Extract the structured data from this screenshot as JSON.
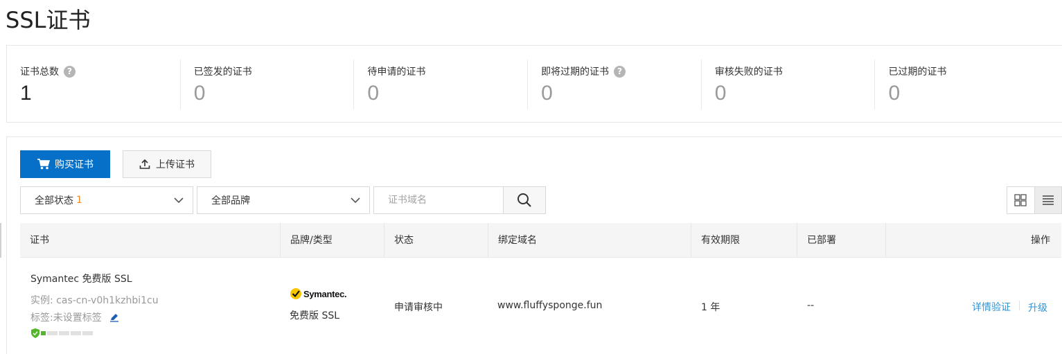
{
  "page": {
    "title": "SSL证书"
  },
  "stats": [
    {
      "label": "证书总数",
      "value": "1",
      "help": true
    },
    {
      "label": "已签发的证书",
      "value": "0",
      "help": false
    },
    {
      "label": "待申请的证书",
      "value": "0",
      "help": false
    },
    {
      "label": "即将过期的证书",
      "value": "0",
      "help": true
    },
    {
      "label": "审核失败的证书",
      "value": "0",
      "help": false
    },
    {
      "label": "已过期的证书",
      "value": "0",
      "help": false
    }
  ],
  "toolbar": {
    "buy_label": "购买证书",
    "upload_label": "上传证书",
    "status_filter": "全部状态",
    "status_count": "1",
    "brand_filter": "全部品牌",
    "search_placeholder": "证书域名"
  },
  "table": {
    "headers": [
      "证书",
      "品牌/类型",
      "状态",
      "绑定域名",
      "有效期限",
      "已部署",
      "操作"
    ],
    "rows": [
      {
        "name": "Symantec 免费版 SSL",
        "instance": "实例: cas-cn-v0h1kzhbi1cu",
        "tags": "标签:未设置标签",
        "brand_logo": "Symantec.",
        "type": "免费版 SSL",
        "status": "申请审核中",
        "domain": "www.fluffysponge.fun",
        "validity": "1 年",
        "deployed": "--",
        "action_detail": "详情验证",
        "action_upgrade": "升级",
        "progress": 0.2
      }
    ]
  },
  "colors": {
    "primary": "#0670c9",
    "link": "#2f94d6",
    "orange": "#f08a24",
    "green": "#52b72b"
  }
}
